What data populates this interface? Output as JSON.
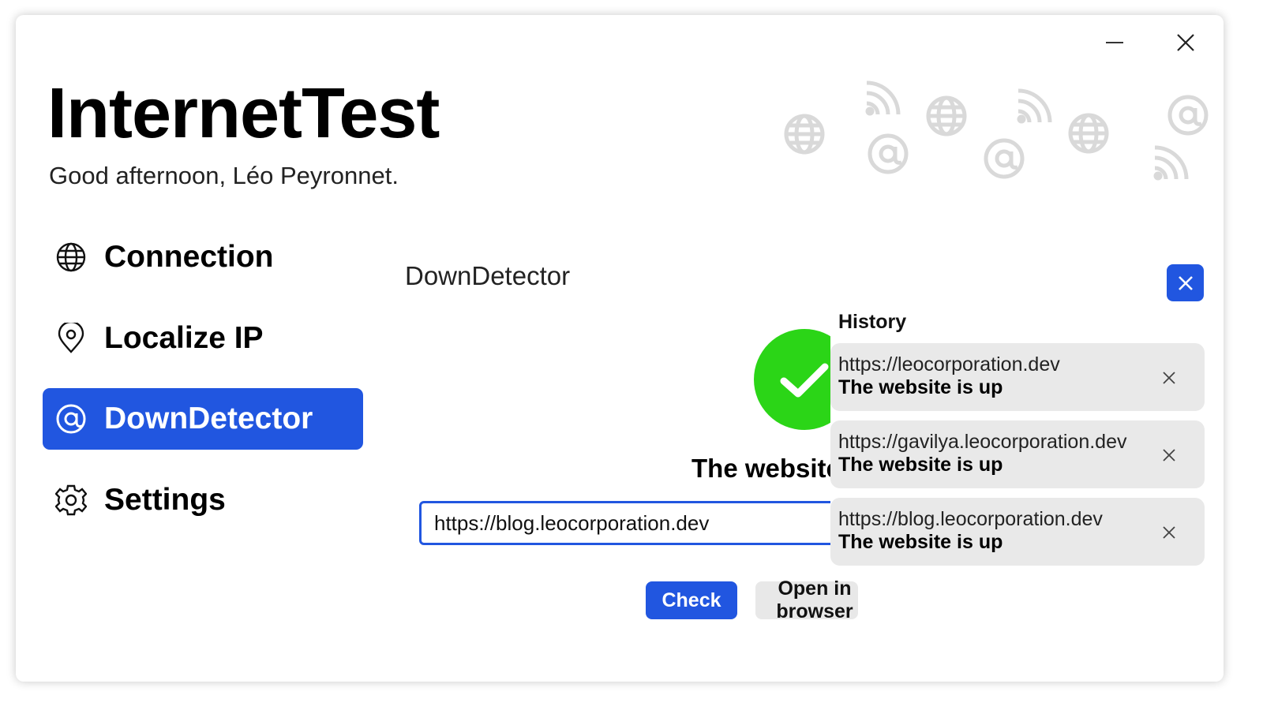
{
  "window": {
    "minimize_icon": "minimize-icon",
    "close_icon": "close-icon"
  },
  "header": {
    "app_title": "InternetTest",
    "greeting": "Good afternoon, Léo Peyronnet."
  },
  "sidebar": {
    "items": [
      {
        "label": "Connection",
        "icon": "globe-icon",
        "active": false
      },
      {
        "label": "Localize IP",
        "icon": "location-pin-icon",
        "active": false
      },
      {
        "label": "DownDetector",
        "icon": "at-sign-icon",
        "active": true
      },
      {
        "label": "Settings",
        "icon": "gear-icon",
        "active": false
      }
    ]
  },
  "main": {
    "page_title": "DownDetector",
    "status_icon": "checkmark-icon",
    "result_text": "The website is up",
    "url_input": {
      "value": "https://blog.leocorporation.dev"
    },
    "check_label": "Check",
    "open_label": "Open in browser"
  },
  "history": {
    "title": "History",
    "items": [
      {
        "url": "https://leocorporation.dev",
        "status": "The website is up"
      },
      {
        "url": "https://gavilya.leocorporation.dev",
        "status": "The website is up"
      },
      {
        "url": "https://blog.leocorporation.dev",
        "status": "The website is up"
      }
    ]
  },
  "colors": {
    "accent": "#2156e0",
    "success": "#2bd517",
    "history_item_bg": "#e9e9e9"
  }
}
